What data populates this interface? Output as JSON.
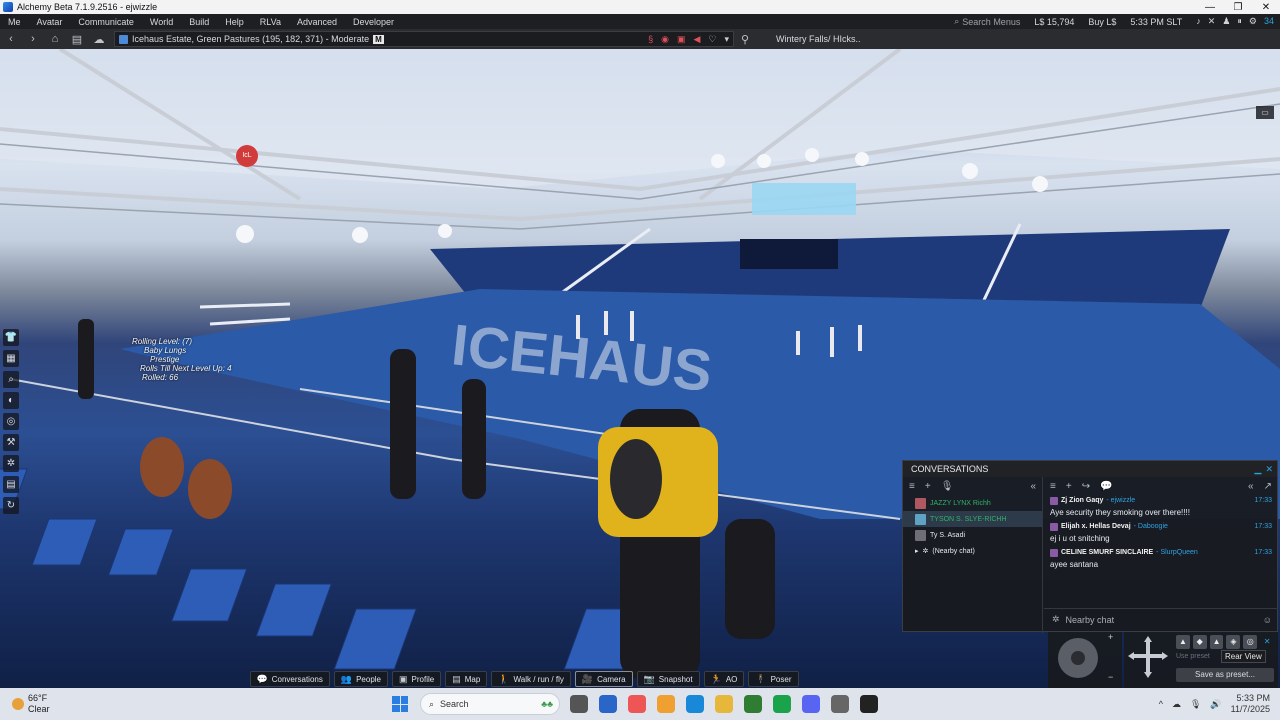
{
  "window": {
    "title": "Alchemy Beta 7.1.9.2516 - ejwizzle"
  },
  "menubar": {
    "items": [
      "Me",
      "Avatar",
      "Communicate",
      "World",
      "Build",
      "Help",
      "RLVa",
      "Advanced",
      "Developer"
    ],
    "search_placeholder": "Search Menus",
    "balance": "L$ 15,794",
    "buy_label": "Buy L$",
    "time": "5:33 PM SLT",
    "fps": "34"
  },
  "navbar": {
    "location": "Icehaus Estate, Green Pastures (195, 182, 371) - Moderate",
    "maturity_badge": "M",
    "parcel_name": "Wintery Falls/ HIcks.."
  },
  "scene": {
    "nametag_lines": [
      "Rolling Level: (7)",
      "Baby Lungs",
      "Prestige",
      "Rolls Till Next Level Up: 4",
      "Rolled: 66"
    ],
    "badge": "IcL"
  },
  "conversations": {
    "title": "CONVERSATIONS",
    "list": [
      {
        "name": "JAZZY LYNX Richh",
        "color": "#30b36a"
      },
      {
        "name": "TYSON S. SLYE-RICHH",
        "color": "#30b36a"
      },
      {
        "name": "Ty S. Asadi",
        "color": "#d9dce2"
      },
      {
        "name": "(Nearby chat)",
        "color": "#d9dce2"
      }
    ],
    "messages": [
      {
        "name": "Zj Zion Gaqy",
        "user": "- ejwizzle",
        "time": "17:33",
        "text": "Aye security they smoking over there!!!!"
      },
      {
        "name": "Elijah x. Hellas Devaj",
        "user": "- Daboogie",
        "time": "17:33",
        "text": "ej i u ot snitching"
      },
      {
        "name": "CELINE SMURF SINCLAIRE",
        "user": "- SlurpQueen",
        "time": "17:33",
        "text": "ayee santana"
      }
    ],
    "input_placeholder": "Nearby chat"
  },
  "camera": {
    "tooltip": "Rear View",
    "use_preset": "Use preset",
    "save_preset": "Save as preset..."
  },
  "bottombar": {
    "buttons": [
      {
        "label": "Conversations",
        "icon": "💬"
      },
      {
        "label": "People",
        "icon": "👥"
      },
      {
        "label": "Profile",
        "icon": "▣"
      },
      {
        "label": "Map",
        "icon": "▤"
      },
      {
        "label": "Walk / run / fly",
        "icon": "🚶"
      },
      {
        "label": "Camera",
        "icon": "🎥"
      },
      {
        "label": "Snapshot",
        "icon": "📷"
      },
      {
        "label": "AO",
        "icon": "🏃"
      },
      {
        "label": "Poser",
        "icon": "🕴"
      }
    ]
  },
  "taskbar": {
    "weather_temp": "66°F",
    "weather_desc": "Clear",
    "search_label": "Search",
    "time": "5:33 PM",
    "date": "11/7/2025",
    "app_colors": [
      "#555",
      "#2a66c8",
      "#e55",
      "#f0a030",
      "#1a88d8",
      "#e7b73c",
      "#2e7d32",
      "#1aa34a",
      "#5865f2",
      "#666",
      "#222"
    ]
  },
  "colors": {
    "accent": "#2fa3e0",
    "alert": "#e0505a"
  }
}
